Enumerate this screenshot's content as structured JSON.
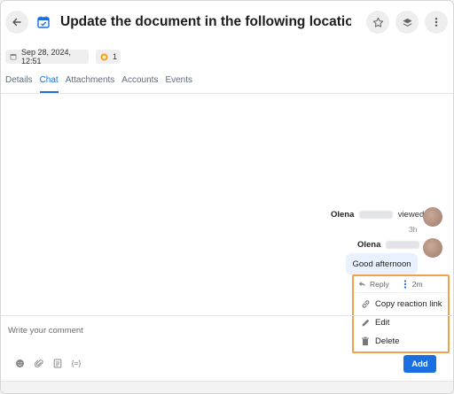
{
  "header": {
    "title": "Update the document in the following locations: RoboH..."
  },
  "meta": {
    "date": "Sep 28, 2024, 12:51",
    "count": "1"
  },
  "tabs": [
    {
      "label": "Details",
      "active": false
    },
    {
      "label": "Chat",
      "active": true
    },
    {
      "label": "Attachments",
      "active": false
    },
    {
      "label": "Accounts",
      "active": false
    },
    {
      "label": "Events",
      "active": false
    }
  ],
  "chat": {
    "viewed_event": {
      "name": "Olena",
      "action": "viewed",
      "time": "3h"
    },
    "message": {
      "name": "Olena",
      "text": "Good afternoon"
    }
  },
  "popup": {
    "reply_label": "Reply",
    "time": "2m",
    "items": [
      {
        "label": "Copy reaction link",
        "icon": "link-icon"
      },
      {
        "label": "Edit",
        "icon": "pencil-icon"
      },
      {
        "label": "Delete",
        "icon": "trash-icon"
      }
    ]
  },
  "composer": {
    "placeholder": "Write your comment",
    "value": "",
    "variable_label": "{=}",
    "add_label": "Add"
  },
  "colors": {
    "accent": "#1b6fe0",
    "highlight": "#f0a14a",
    "bubble": "#e8f1fd"
  }
}
